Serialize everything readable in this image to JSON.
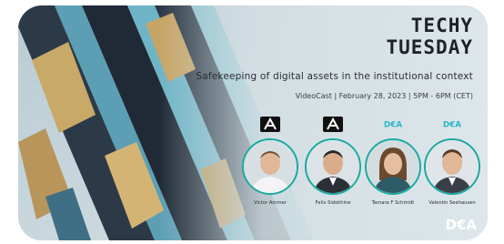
{
  "event": {
    "title_line1": "TECHY",
    "title_line2": "TUESDAY",
    "subtitle": "Safekeeping of digital assets in the institutional context",
    "details": "VideoCast | February 28, 2023 | 5PM - 6PM (CET)"
  },
  "speakers": [
    {
      "name": "Victor Ammer",
      "logo": "black-a-logo"
    },
    {
      "name": "Felix Sidokhine",
      "logo": "black-a-logo"
    },
    {
      "name": "Tamara F Schmidt",
      "logo": "dea-logo"
    },
    {
      "name": "Valentin Seehausen",
      "logo": "dea-logo"
    }
  ],
  "brand": {
    "corner_logo": "D€A",
    "dea_logo_text": "D€A",
    "accent": "#1aa9a0",
    "title_color": "#1e2226"
  }
}
